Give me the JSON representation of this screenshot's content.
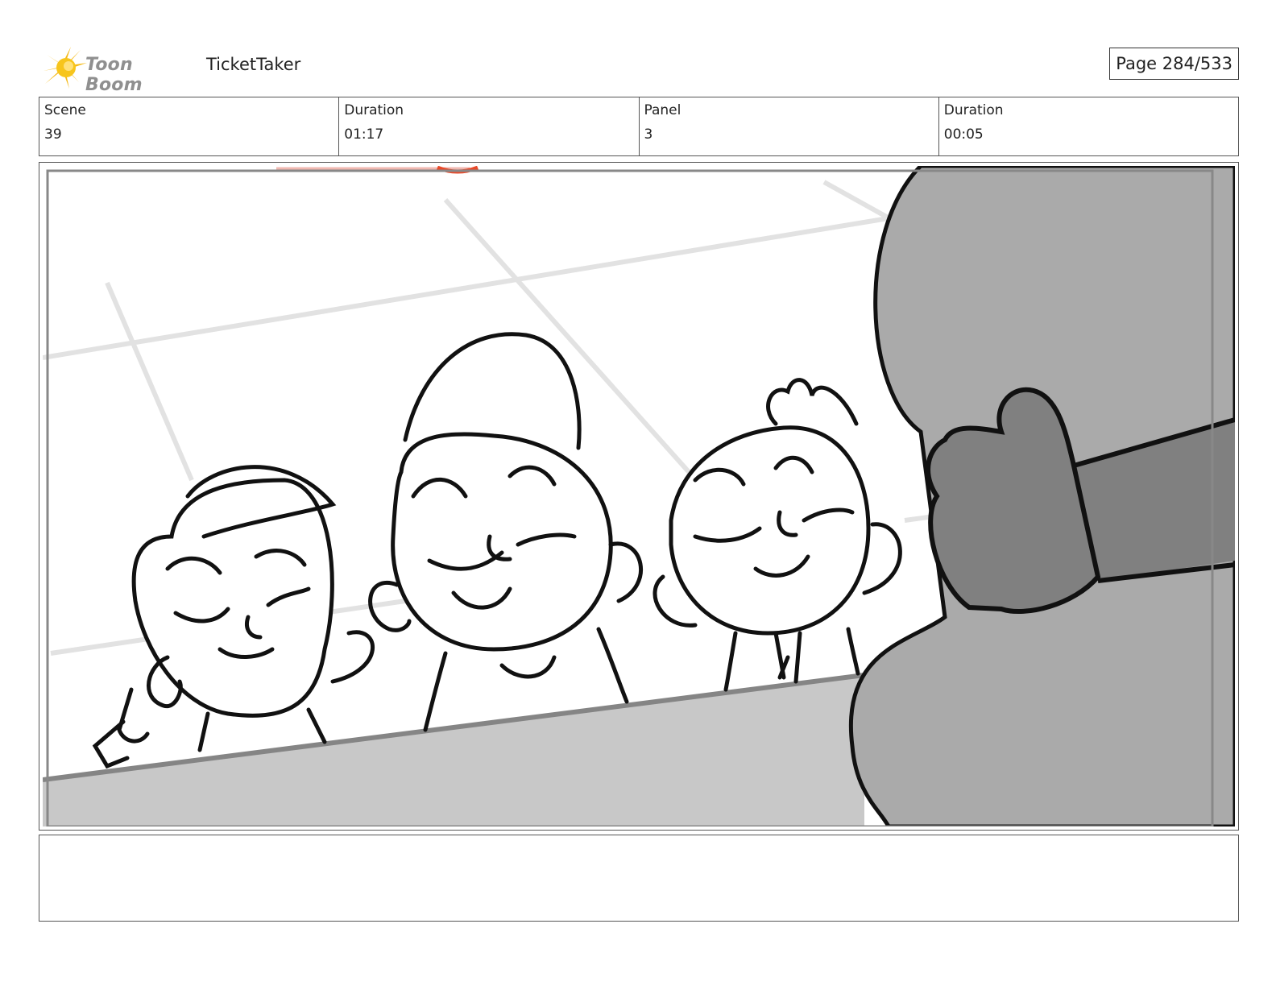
{
  "header": {
    "logo_text": "Toon Boom",
    "project_title": "TicketTaker",
    "page_label": "Page 284/533"
  },
  "info": {
    "scene_label": "Scene",
    "scene_value": "39",
    "scene_duration_label": "Duration",
    "scene_duration_value": "01:17",
    "panel_label": "Panel",
    "panel_value": "3",
    "panel_duration_label": "Duration",
    "panel_duration_value": "00:05"
  },
  "panel": {
    "description": "",
    "colors": {
      "counter": "#c8c8c8",
      "body": "#aaaaaa",
      "hand": "#808080",
      "grid": "#e2e2e2",
      "ink": "#111111"
    }
  },
  "notes": {
    "text": ""
  }
}
